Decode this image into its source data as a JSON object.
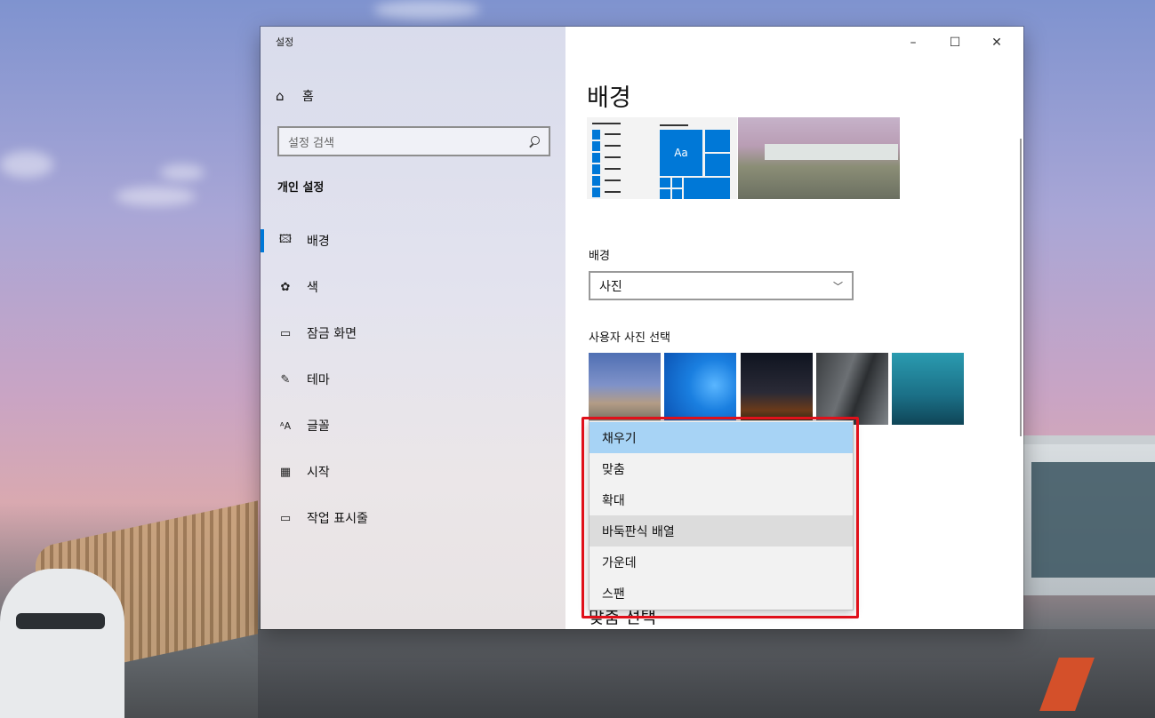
{
  "window": {
    "app_title": "설정",
    "controls": {
      "minimize": "–",
      "maximize": "☐",
      "close": "✕"
    }
  },
  "nav": {
    "home": {
      "icon": "home-icon",
      "label": "홈"
    },
    "search_placeholder": "설정 검색",
    "section": "개인 설정",
    "items": [
      {
        "icon": "picture-icon",
        "label": "배경",
        "selected": true
      },
      {
        "icon": "palette-icon",
        "label": "색"
      },
      {
        "icon": "lock-screen-icon",
        "label": "잠금 화면"
      },
      {
        "icon": "theme-icon",
        "label": "테마"
      },
      {
        "icon": "font-icon",
        "label": "글꼴"
      },
      {
        "icon": "start-icon",
        "label": "시작"
      },
      {
        "icon": "taskbar-icon",
        "label": "작업 표시줄"
      }
    ]
  },
  "content": {
    "page_title": "배경",
    "preview_tile_text": "Aa",
    "background_label": "배경",
    "background_value": "사진",
    "choose_photo_label": "사용자 사진 선택",
    "lower_partial_text": "맞춤 선택",
    "fit_options": [
      {
        "label": "채우기",
        "state": "selected"
      },
      {
        "label": "맞춤",
        "state": ""
      },
      {
        "label": "확대",
        "state": ""
      },
      {
        "label": "바둑판식 배열",
        "state": "hover"
      },
      {
        "label": "가운데",
        "state": ""
      },
      {
        "label": "스팬",
        "state": ""
      }
    ]
  },
  "colors": {
    "accent": "#0078d7",
    "highlight_border": "#e0101a",
    "selected_option": "#a7d3f5"
  }
}
